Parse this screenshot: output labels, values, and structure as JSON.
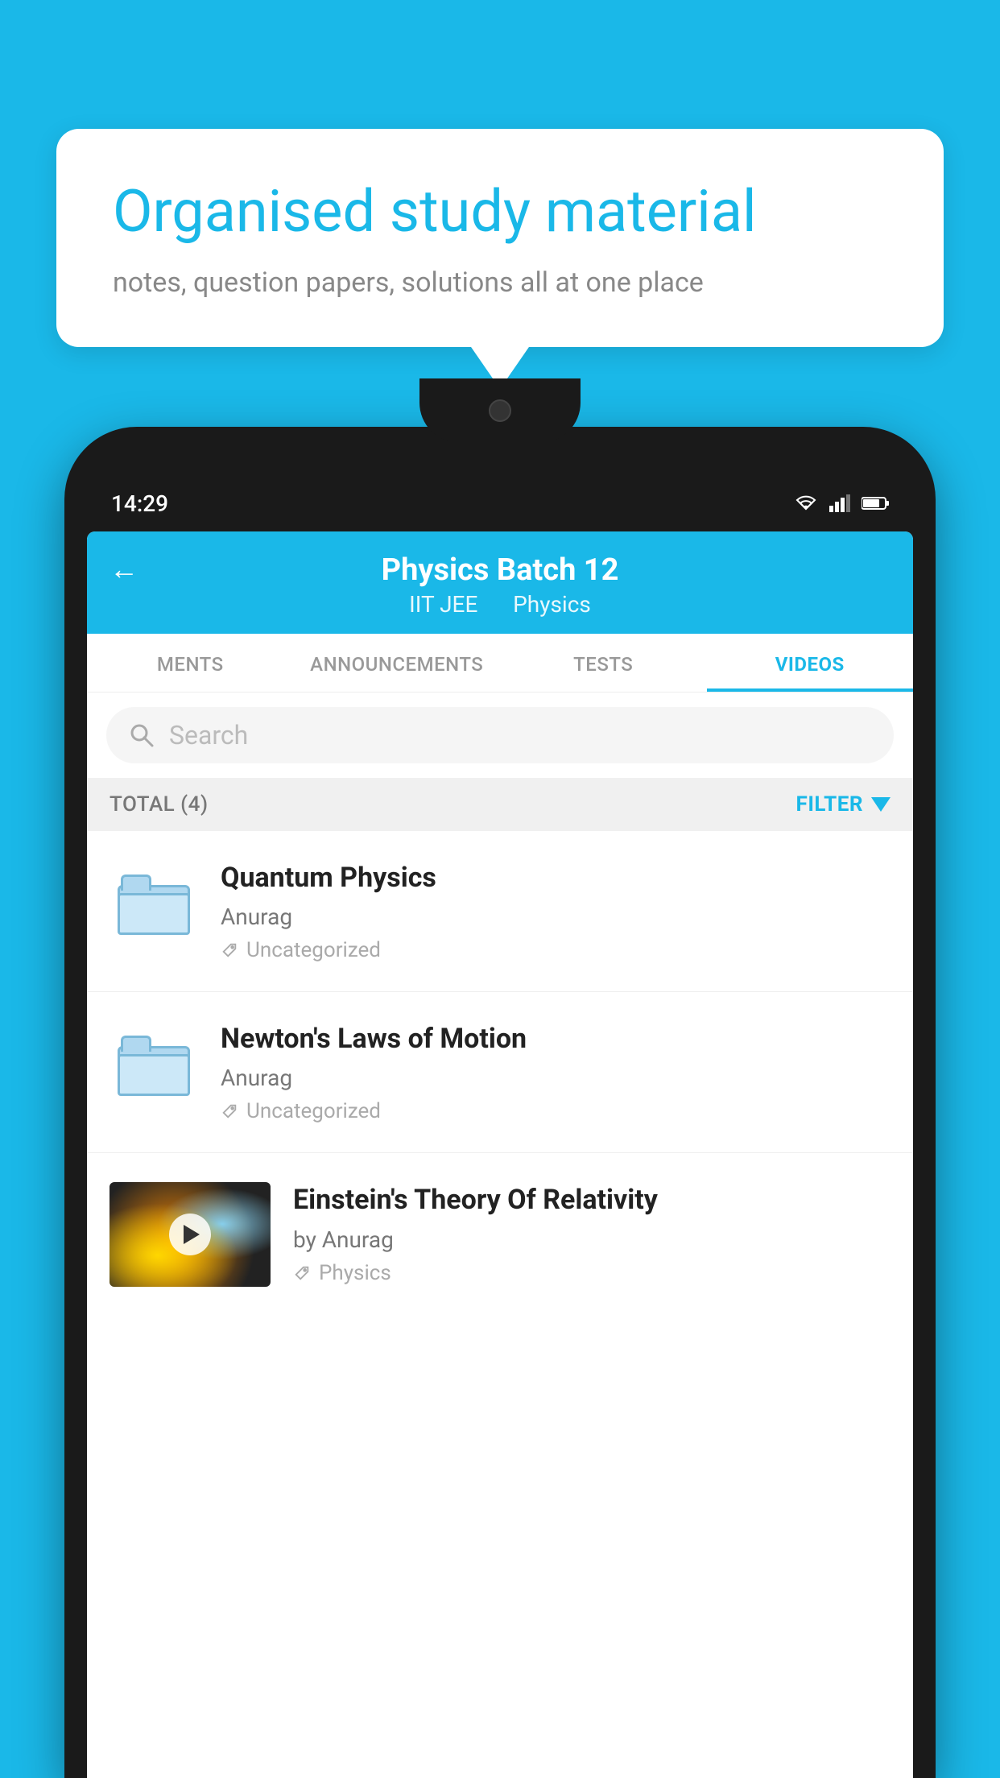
{
  "bubble": {
    "title": "Organised study material",
    "subtitle": "notes, question papers, solutions all at one place"
  },
  "phone": {
    "time": "14:29",
    "header": {
      "title": "Physics Batch 12",
      "subtitle_part1": "IIT JEE",
      "subtitle_part2": "Physics"
    },
    "tabs": [
      {
        "label": "MENTS",
        "active": false
      },
      {
        "label": "ANNOUNCEMENTS",
        "active": false
      },
      {
        "label": "TESTS",
        "active": false
      },
      {
        "label": "VIDEOS",
        "active": true
      }
    ],
    "search": {
      "placeholder": "Search"
    },
    "filter": {
      "total_label": "TOTAL (4)",
      "filter_label": "FILTER"
    },
    "videos": [
      {
        "title": "Quantum Physics",
        "author": "Anurag",
        "tag": "Uncategorized",
        "has_thumb": false
      },
      {
        "title": "Newton's Laws of Motion",
        "author": "Anurag",
        "tag": "Uncategorized",
        "has_thumb": false
      },
      {
        "title": "Einstein's Theory Of Relativity",
        "author": "by Anurag",
        "tag": "Physics",
        "has_thumb": true
      }
    ]
  }
}
